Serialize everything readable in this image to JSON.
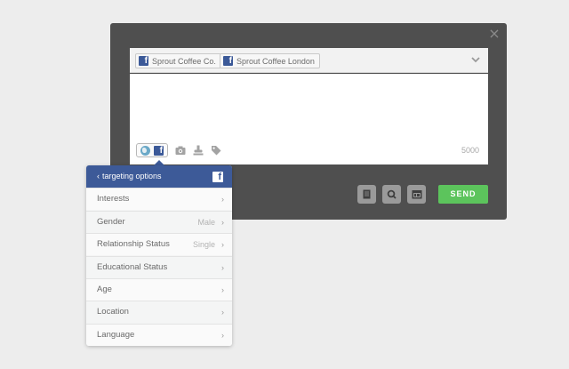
{
  "composer": {
    "close_glyph": "×",
    "profiles": [
      {
        "name": "Sprout Coffee Co.",
        "network": "facebook"
      },
      {
        "name": "Sprout Coffee London",
        "network": "facebook"
      }
    ],
    "character_count": "5000",
    "send_label": "SEND",
    "colors": {
      "panel": "#4f4f4f",
      "send": "#5cc45c",
      "facebook": "#3b5998"
    }
  },
  "targeting": {
    "back_glyph": "‹",
    "title": "targeting options",
    "options": [
      {
        "label": "Interests",
        "value": ""
      },
      {
        "label": "Gender",
        "value": "Male"
      },
      {
        "label": "Relationship Status",
        "value": "Single"
      },
      {
        "label": "Educational Status",
        "value": ""
      },
      {
        "label": "Age",
        "value": ""
      },
      {
        "label": "Location",
        "value": ""
      },
      {
        "label": "Language",
        "value": ""
      }
    ],
    "chevron_glyph": "›"
  },
  "icons": {
    "globe": "globe-icon",
    "facebook": "facebook-icon",
    "camera": "camera-icon",
    "stamp": "stamp-icon",
    "tag": "tag-icon",
    "notes": "notepad-icon",
    "search": "search-icon",
    "calendar": "calendar-icon",
    "chevron": "chevron-down-icon"
  }
}
